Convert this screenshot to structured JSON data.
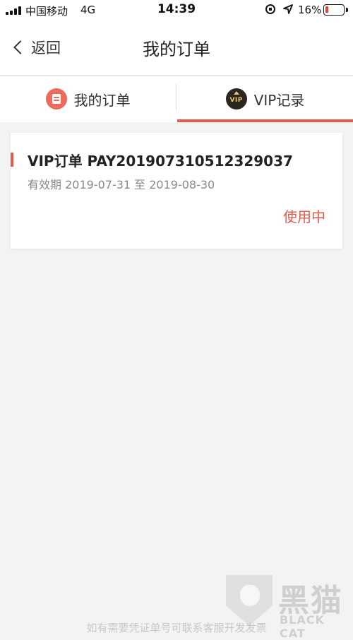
{
  "status_bar": {
    "carrier": "中国移动",
    "network": "4G",
    "time": "14:39",
    "battery_percent": "16%",
    "battery_level": 0.16,
    "battery_color": "#e8413a"
  },
  "nav": {
    "back_label": "返回",
    "title": "我的订单"
  },
  "tabs": [
    {
      "label": "我的订单",
      "icon": "order-list-icon",
      "active": false
    },
    {
      "label": "VIP记录",
      "icon": "vip-badge-icon",
      "icon_text": "VIP",
      "active": true
    }
  ],
  "orders": [
    {
      "title": "VIP订单 PAY201907310512329037",
      "validity": "有效期 2019-07-31 至 2019-08-30",
      "status": "使用中"
    }
  ],
  "watermark": {
    "cn": "黑猫",
    "en": "BLACK CAT"
  },
  "bottom_hint": "如有需要凭证单号可联系客服开发发票",
  "colors": {
    "accent": "#e25b4b",
    "background": "#f3f3f3"
  }
}
